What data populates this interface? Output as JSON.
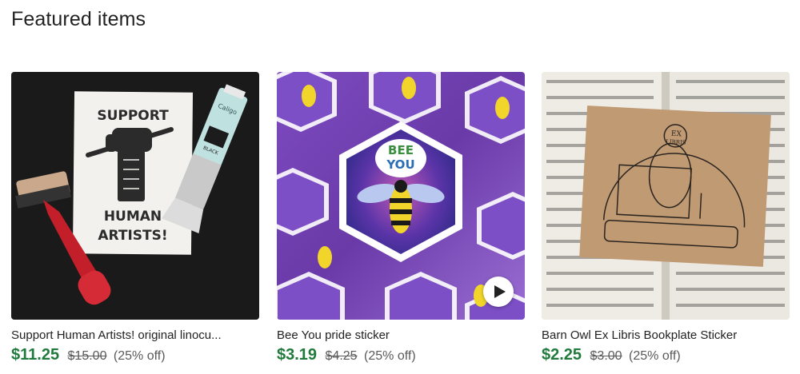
{
  "section": {
    "title": "Featured items"
  },
  "items": [
    {
      "title": "Support Human Artists! original linocu...",
      "price": "$11.25",
      "original_price": "$15.00",
      "discount": "(25% off)",
      "image": {
        "poster_lines": [
          "SUPPORT",
          "HUMAN",
          "ARTISTS!"
        ],
        "tube_brand": "Caligo",
        "tube_label": "BLACK"
      }
    },
    {
      "title": "Bee You pride sticker",
      "price": "$3.19",
      "original_price": "$4.25",
      "discount": "(25% off)",
      "image": {
        "sticker_text": [
          "BEE",
          "YOU"
        ],
        "has_video": true
      }
    },
    {
      "title": "Barn Owl Ex Libris Bookplate Sticker",
      "price": "$2.25",
      "original_price": "$3.00",
      "discount": "(25% off)",
      "image": {
        "stamp_text": [
          "EX",
          "LIBRIS"
        ]
      }
    }
  ],
  "colors": {
    "sale_price": "#1f7a3c",
    "muted_text": "#595959",
    "heading_text": "#222222"
  },
  "icons": {
    "play": "play-icon"
  }
}
